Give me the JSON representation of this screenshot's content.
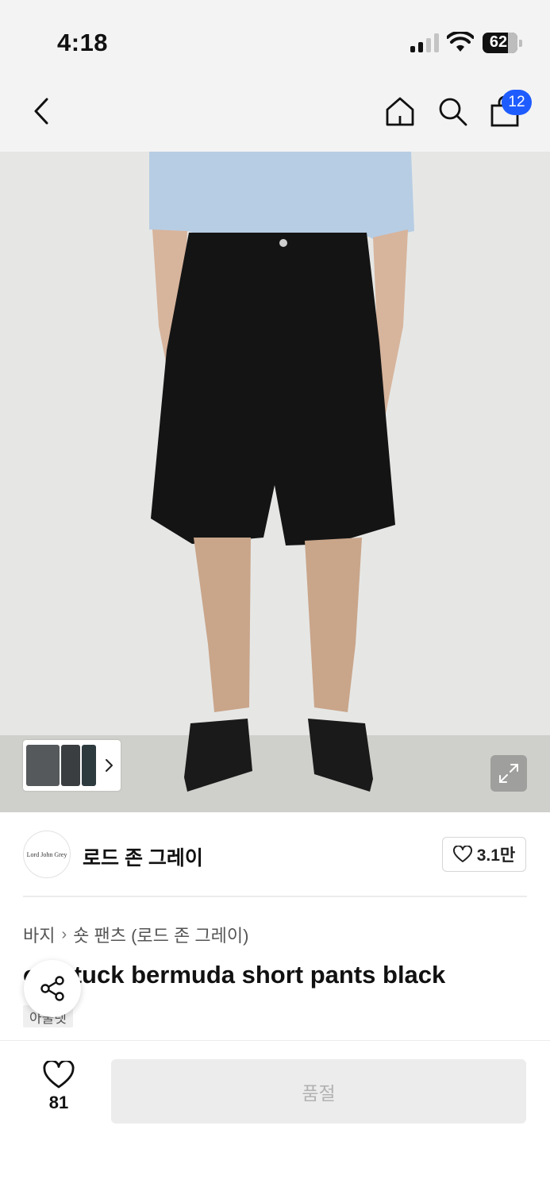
{
  "status_bar": {
    "time": "4:18",
    "battery_percent": "62",
    "signal_bars": 2
  },
  "nav": {
    "back_icon": "chevron-left-icon",
    "home_icon": "home-icon",
    "search_icon": "search-icon",
    "cart_icon": "shopping-bag-icon",
    "cart_badge": "12",
    "badge_color": "#1f5cff"
  },
  "gallery": {
    "thumbnail_count": 3,
    "expand_icon": "expand-icon"
  },
  "brand": {
    "logo_text": "Lord John Grey",
    "name": "로드 존 그레이",
    "likes": "3.1만"
  },
  "product": {
    "breadcrumb": [
      "바지",
      "숏 팬츠 (로드 존 그레이)"
    ],
    "title": "one tuck bermuda short pants black",
    "tag": "아울렛"
  },
  "bottom_bar": {
    "wish_count": "81",
    "buy_label": "품절"
  }
}
